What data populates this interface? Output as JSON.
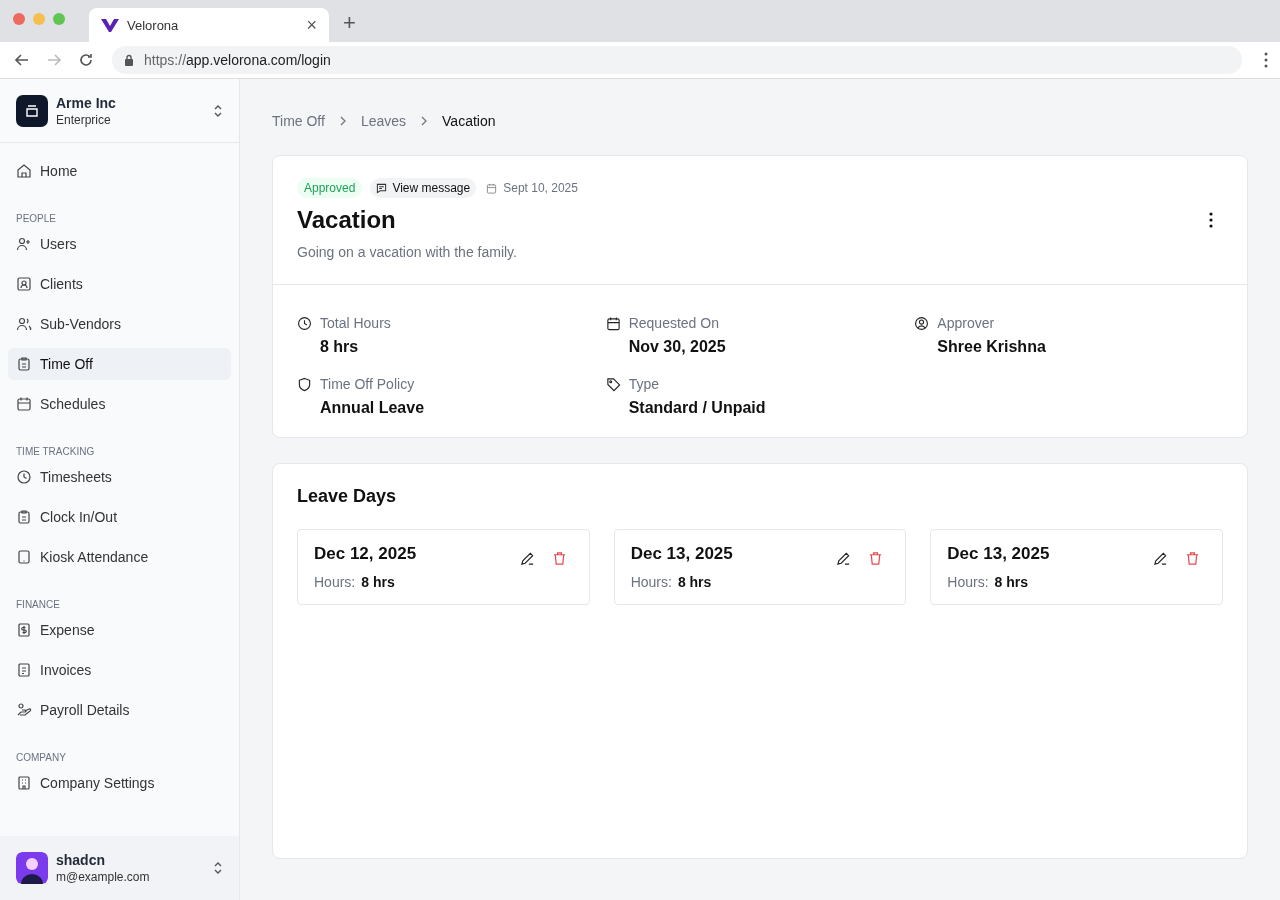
{
  "browser": {
    "tab_title": "Velorona",
    "tab_close": "×",
    "new_tab": "+",
    "url_scheme": "https://",
    "url_rest": "app.velorona.com/login"
  },
  "sidebar": {
    "org": {
      "name": "Arme Inc",
      "plan": "Enterprice"
    },
    "sections": [
      {
        "items": [
          {
            "label": "Home",
            "selected": false
          }
        ]
      },
      {
        "title": "PEOPLE",
        "items": [
          {
            "label": "Users",
            "selected": false
          },
          {
            "label": "Clients",
            "selected": false
          },
          {
            "label": "Sub-Vendors",
            "selected": false
          },
          {
            "label": "Time Off",
            "selected": true
          },
          {
            "label": "Schedules",
            "selected": false
          }
        ]
      },
      {
        "title": "TIME TRACKING",
        "items": [
          {
            "label": "Timesheets",
            "selected": false
          },
          {
            "label": "Clock In/Out",
            "selected": false
          },
          {
            "label": "Kiosk Attendance",
            "selected": false
          }
        ]
      },
      {
        "title": "FINANCE",
        "items": [
          {
            "label": "Expense",
            "selected": false
          },
          {
            "label": "Invoices",
            "selected": false
          },
          {
            "label": "Payroll Details",
            "selected": false
          }
        ]
      },
      {
        "title": "COMPANY",
        "items": [
          {
            "label": "Company Settings",
            "selected": false
          }
        ]
      }
    ],
    "user": {
      "name": "shadcn",
      "email": "m@example.com"
    }
  },
  "breadcrumb": [
    "Time Off",
    "Leaves",
    "Vacation"
  ],
  "request": {
    "status": "Approved",
    "view_message": "View message",
    "date": "Sept 10, 2025",
    "title": "Vacation",
    "description": "Going on a vacation with the family.",
    "details": [
      {
        "label": "Total Hours",
        "value": "8 hrs"
      },
      {
        "label": "Requested On",
        "value": "Nov 30, 2025"
      },
      {
        "label": "Approver",
        "value": "Shree Krishna"
      },
      {
        "label": "Time Off Policy",
        "value": "Annual Leave"
      },
      {
        "label": "Type",
        "value": "Standard / Unpaid"
      }
    ]
  },
  "leave_days": {
    "title": "Leave Days",
    "days": [
      {
        "date": "Dec 12, 2025",
        "hours_label": "Hours:",
        "hours": "8 hrs"
      },
      {
        "date": "Dec 13, 2025",
        "hours_label": "Hours:",
        "hours": "8 hrs"
      },
      {
        "date": "Dec 13, 2025",
        "hours_label": "Hours:",
        "hours": "8 hrs"
      }
    ]
  }
}
